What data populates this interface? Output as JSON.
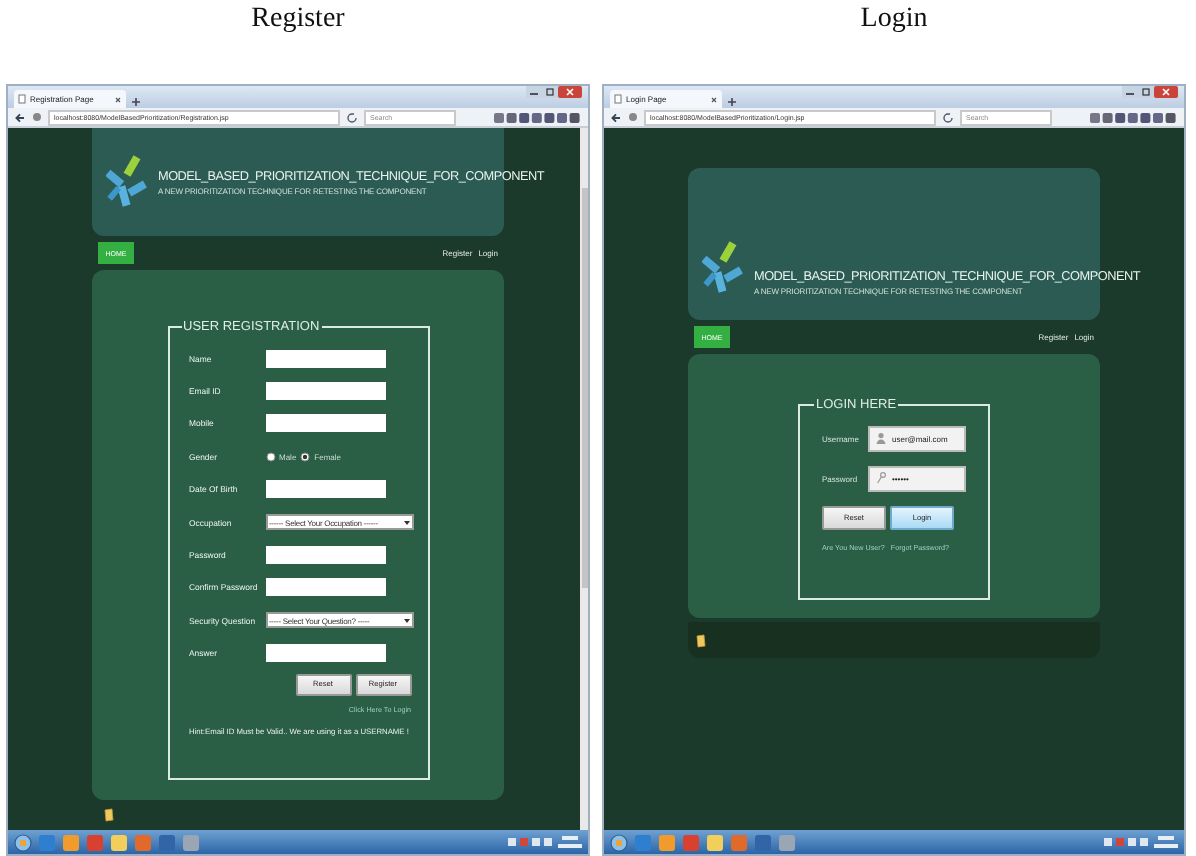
{
  "panels": [
    {
      "caption": "Register",
      "kind": "register",
      "browser": {
        "tab_title": "Registration Page",
        "address": "localhost:8080/ModelBasedPrioritization/Registration.jsp",
        "search_placeholder": "Search"
      },
      "site": {
        "title": "MODEL_BASED_PRIORITIZATION_TECHNIQUE_FOR_COMPONENT",
        "subtitle": "A NEW PRIORITIZATION TECHNIQUE FOR RETESTING THE COMPONENT",
        "home_button": "HOME",
        "nav_links": [
          "Register",
          "Login"
        ]
      },
      "form": {
        "legend": "USER REGISTRATION",
        "fields": [
          {
            "label": "Name",
            "kind": "text"
          },
          {
            "label": "Email ID",
            "kind": "text"
          },
          {
            "label": "Mobile",
            "kind": "text"
          },
          {
            "label": "Gender",
            "kind": "radio",
            "options": [
              {
                "label": "Male",
                "selected": false
              },
              {
                "label": "Female",
                "selected": true
              }
            ]
          },
          {
            "label": "Date Of Birth",
            "kind": "text"
          },
          {
            "label": "Occupation",
            "kind": "select",
            "value": "------ Select Your Occupation ------"
          },
          {
            "label": "Password",
            "kind": "text"
          },
          {
            "label": "Confirm Password",
            "kind": "text"
          },
          {
            "label": "Security Question",
            "kind": "select",
            "value": "----- Select Your Question? -----"
          },
          {
            "label": "Answer",
            "kind": "text"
          }
        ],
        "buttons": [
          {
            "label": "Reset",
            "selected": false
          },
          {
            "label": "Register",
            "selected": false
          }
        ],
        "links": [
          "Click Here To Login"
        ],
        "hint": "Hint:Email ID Must be Valid.. We are using it as a USERNAME !"
      }
    },
    {
      "caption": "Login",
      "kind": "login",
      "browser": {
        "tab_title": "Login Page",
        "address": "localhost:8080/ModelBasedPrioritization/Login.jsp",
        "search_placeholder": "Search"
      },
      "site": {
        "title": "MODEL_BASED_PRIORITIZATION_TECHNIQUE_FOR_COMPONENT",
        "subtitle": "A NEW PRIORITIZATION TECHNIQUE FOR RETESTING THE COMPONENT",
        "home_button": "HOME",
        "nav_links": [
          "Register",
          "Login"
        ]
      },
      "form": {
        "legend": "LOGIN HERE",
        "fields": [
          {
            "label": "Username",
            "kind": "user",
            "value": "user@mail.com"
          },
          {
            "label": "Password",
            "kind": "password",
            "value": "••••••"
          }
        ],
        "buttons": [
          {
            "label": "Reset",
            "selected": false
          },
          {
            "label": "Login",
            "selected": true
          }
        ],
        "links": [
          "Are You New User?",
          "Forgot Password?"
        ]
      }
    }
  ]
}
